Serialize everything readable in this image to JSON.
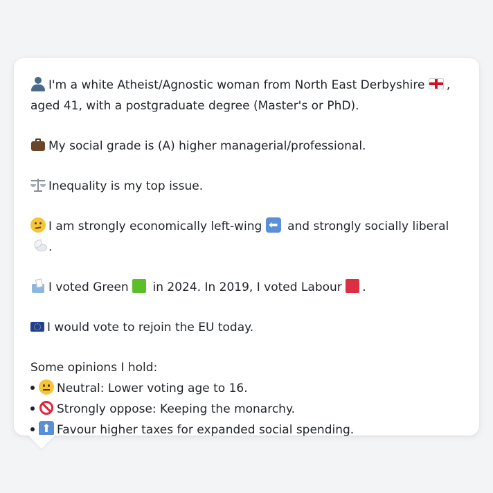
{
  "intro": {
    "icon": "person-silhouette-icon",
    "text_a": "I'm a white Atheist/Agnostic woman from North East Derbyshire",
    "flag_icon": "england-flag-icon",
    "text_b": ", aged 41, with a postgraduate degree (Master's or PhD)."
  },
  "social_grade": {
    "icon": "briefcase-icon",
    "text": "My social grade is (A) higher managerial/professional."
  },
  "top_issue": {
    "icon": "balance-scale-icon",
    "text": "Inequality is my top issue."
  },
  "ideology": {
    "icon": "thinking-face-icon",
    "text_a": "I am strongly economically left-wing",
    "left_icon": "left-arrow-icon",
    "text_b": "and strongly socially liberal",
    "dove_icon": "dove-icon",
    "text_c": "."
  },
  "votes": {
    "icon": "ballot-box-icon",
    "text_a": "I voted Green",
    "green_icon": "green-square-icon",
    "text_b": "in 2024. In 2019, I voted Labour",
    "red_icon": "red-square-icon",
    "text_c": "."
  },
  "eu": {
    "icon": "eu-flag-icon",
    "text": "I would vote to rejoin the EU today."
  },
  "opinions": {
    "heading": "Some opinions I hold:",
    "items": [
      {
        "icon": "neutral-face-icon",
        "text": "Neutral: Lower voting age to 16."
      },
      {
        "icon": "prohibited-icon",
        "text": "Strongly oppose: Keeping the monarchy."
      },
      {
        "icon": "up-arrow-icon",
        "text": "Favour higher taxes for expanded social spending."
      }
    ]
  },
  "colors": {
    "page_bg": "#f3f4f6",
    "bubble_bg": "#ffffff",
    "text": "#1f2328"
  }
}
